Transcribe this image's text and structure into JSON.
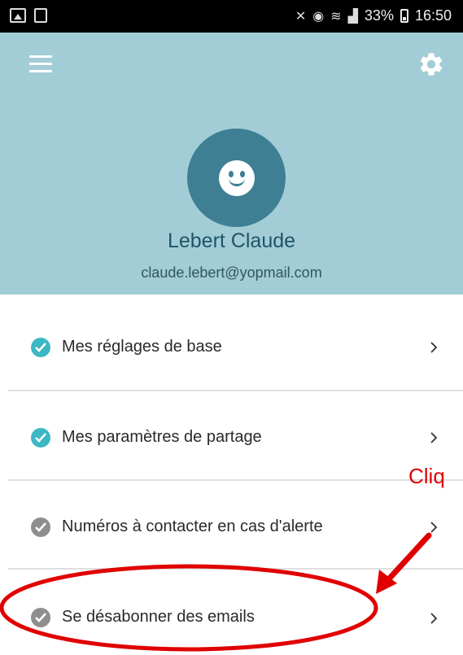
{
  "status_bar": {
    "battery": "33%",
    "time": "16:50"
  },
  "header": {
    "menu_icon": "hamburger-menu-icon",
    "settings_icon": "gear-icon",
    "avatar_icon": "smiley-face-icon",
    "user_name": "Lebert Claude",
    "user_email": "claude.lebert@yopmail.com",
    "background_color": "#a3cdd6",
    "avatar_color": "#3e7f93"
  },
  "menu": {
    "items": [
      {
        "label": "Mes réglages de base",
        "status": "complete",
        "check_color": "#3bb8c4"
      },
      {
        "label": "Mes paramètres de partage",
        "status": "complete",
        "check_color": "#3bb8c4"
      },
      {
        "label": "Numéros à contacter en cas d'alerte",
        "status": "incomplete",
        "check_color": "#8e8e8e"
      },
      {
        "label": "Se désabonner des emails",
        "status": "incomplete",
        "check_color": "#8e8e8e"
      }
    ]
  },
  "annotation": {
    "text": "Cliq",
    "color": "#e00000"
  }
}
